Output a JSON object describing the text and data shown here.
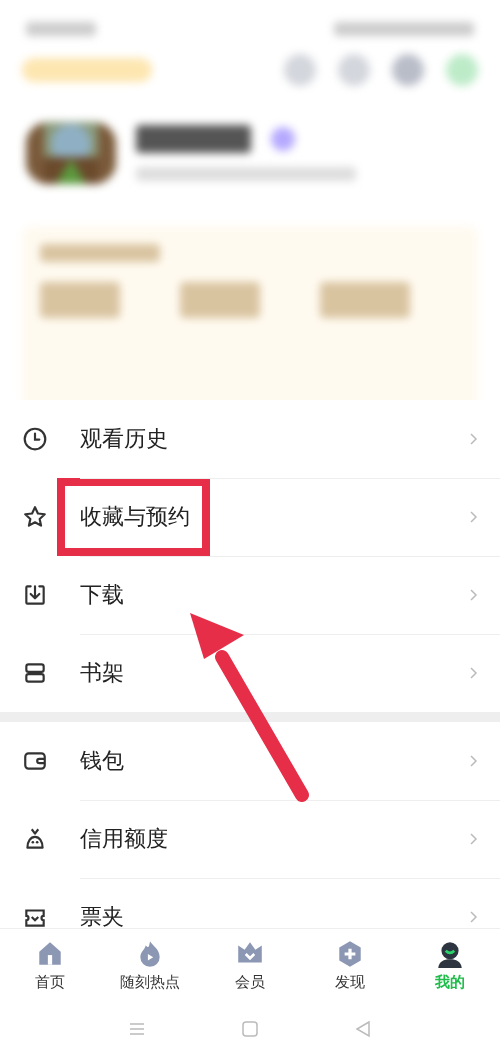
{
  "menu_groups": [
    {
      "items": [
        {
          "label": "观看历史",
          "highlighted": false
        },
        {
          "label": "收藏与预约",
          "highlighted": true
        },
        {
          "label": "下载",
          "highlighted": false
        },
        {
          "label": "书架",
          "highlighted": false
        }
      ]
    },
    {
      "items": [
        {
          "label": "钱包",
          "highlighted": false
        },
        {
          "label": "信用额度",
          "highlighted": false
        },
        {
          "label": "票夹",
          "highlighted": false
        }
      ]
    }
  ],
  "bottom_nav": [
    {
      "label": "首页",
      "selected": false
    },
    {
      "label": "随刻热点",
      "selected": false
    },
    {
      "label": "会员",
      "selected": false
    },
    {
      "label": "发现",
      "selected": false
    },
    {
      "label": "我的",
      "selected": true
    }
  ],
  "annotation": {
    "arrow": true
  }
}
